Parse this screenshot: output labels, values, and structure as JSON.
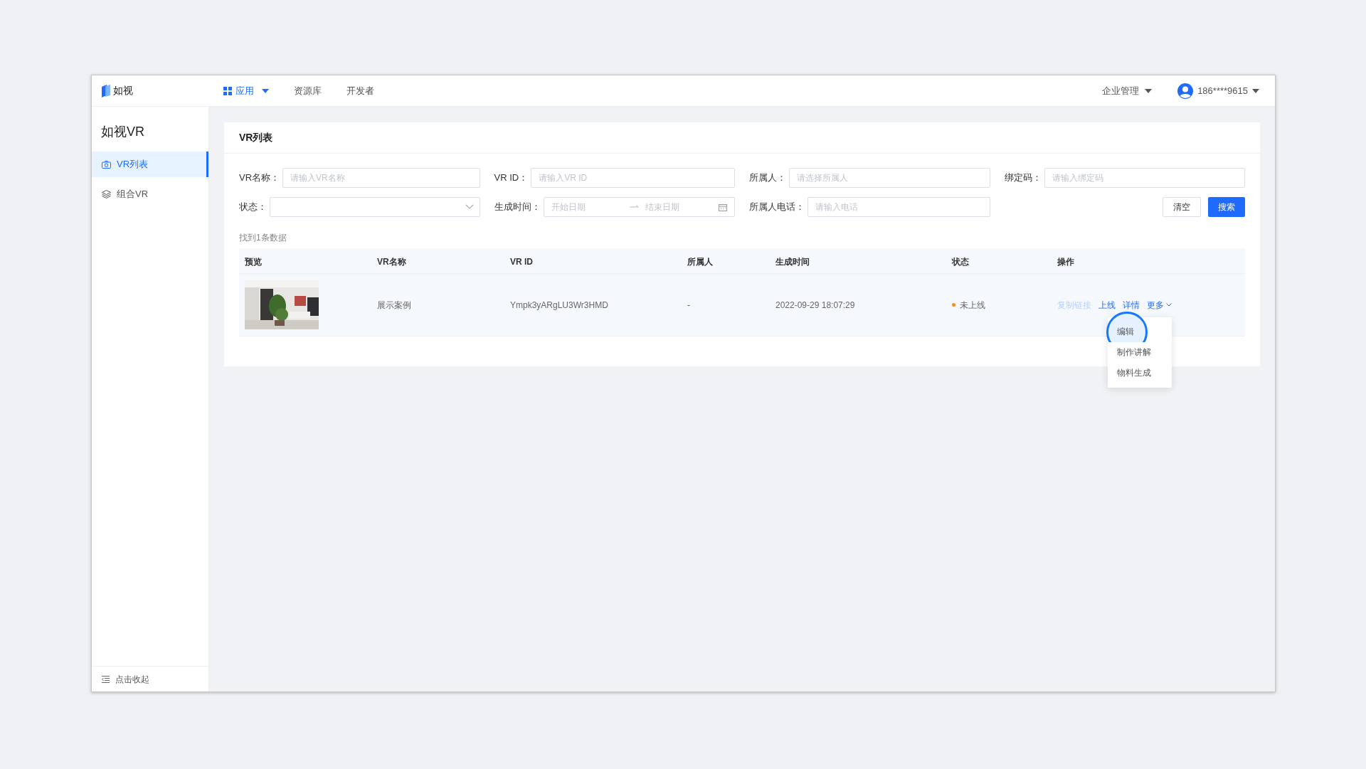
{
  "brand": {
    "name": "如视"
  },
  "nav": [
    {
      "label": "应用",
      "selected": true,
      "kind": "menu"
    },
    {
      "label": "资源库",
      "selected": false,
      "kind": "link"
    },
    {
      "label": "开发者",
      "selected": false,
      "kind": "link"
    }
  ],
  "header_right": {
    "enterprise": "企业管理",
    "user": "186****9615"
  },
  "sidebar": {
    "title": "如视VR",
    "items": [
      {
        "label": "VR列表",
        "selected": true,
        "kind": "camera"
      },
      {
        "label": "组合VR",
        "selected": false,
        "kind": "layers"
      }
    ],
    "collapse": "点击收起"
  },
  "page": {
    "title": "VR列表",
    "filters": [
      {
        "kind": "text",
        "label": "VR名称：",
        "placeholder": "请输入VR名称"
      },
      {
        "kind": "text",
        "label": "VR ID：",
        "placeholder": "请输入VR ID"
      },
      {
        "kind": "text",
        "label": "所属人：",
        "placeholder": "请选择所属人"
      },
      {
        "kind": "text",
        "label": "绑定码：",
        "placeholder": "请输入绑定码"
      },
      {
        "kind": "select",
        "label": "状态："
      },
      {
        "kind": "daterange",
        "label": "生成时间：",
        "start_placeholder": "开始日期",
        "end_placeholder": "结束日期"
      },
      {
        "kind": "text",
        "label": "所属人电话：",
        "placeholder": "请输入电话"
      }
    ],
    "buttons": [
      {
        "label": "清空",
        "kind": "default"
      },
      {
        "label": "搜索",
        "kind": "primary"
      }
    ],
    "result_count": "找到1条数据",
    "table": {
      "columns": [
        "预览",
        "VR名称",
        "VR ID",
        "所属人",
        "生成时间",
        "状态",
        "操作"
      ],
      "rows": [
        {
          "name": "展示案例",
          "vr_id": "Ympk3yARgLU3Wr3HMD",
          "owner": "-",
          "created": "2022-09-29 18:07:29",
          "status": {
            "label": "未上线",
            "color": "#fa8c16"
          },
          "actions": [
            {
              "label": "复制链接",
              "disabled": true
            },
            {
              "label": "上线",
              "disabled": false
            },
            {
              "label": "详情",
              "disabled": false
            }
          ],
          "more": "更多",
          "menu": [
            {
              "label": "编辑",
              "selected": true
            },
            {
              "label": "制作讲解",
              "selected": false
            },
            {
              "label": "物料生成",
              "selected": false
            }
          ]
        }
      ]
    }
  }
}
